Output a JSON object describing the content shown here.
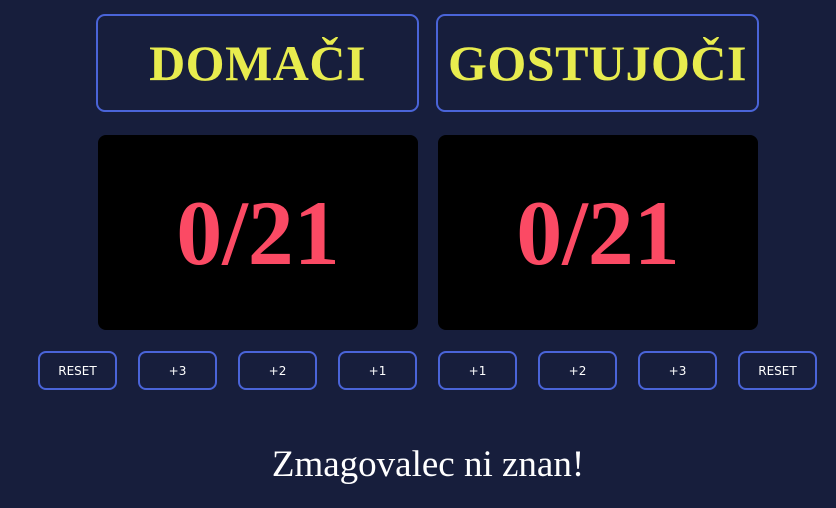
{
  "home": {
    "label": "DOMAČI",
    "score": "0/21"
  },
  "guest": {
    "label": "GOSTUJOČI",
    "score": "0/21"
  },
  "controls": {
    "home_reset": "RESET",
    "home_plus3": "+3",
    "home_plus2": "+2",
    "home_plus1": "+1",
    "guest_plus1": "+1",
    "guest_plus2": "+2",
    "guest_plus3": "+3",
    "guest_reset": "RESET"
  },
  "status": {
    "winner_text": "Zmagovalec ni znan!"
  },
  "colors": {
    "background": "#171e3c",
    "border_accent": "#4a64d8",
    "team_label": "#e8ec4e",
    "score": "#fb4a64"
  }
}
